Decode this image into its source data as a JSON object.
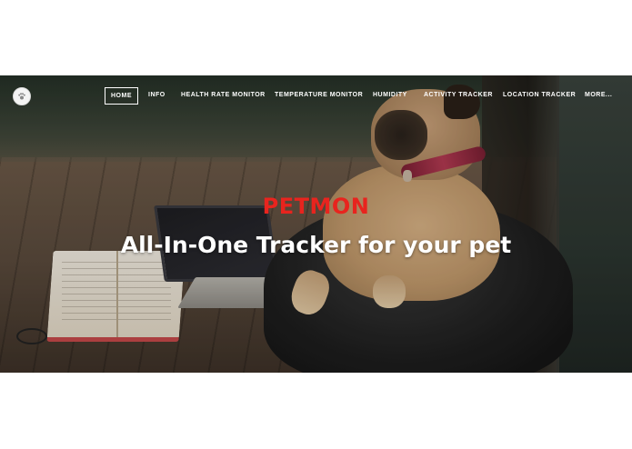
{
  "nav": {
    "logo_icon": "pet-logo-icon",
    "items": [
      {
        "label": "HOME",
        "active": true
      },
      {
        "label": "INFO",
        "active": false
      },
      {
        "label": "HEALTH RATE MONITOR",
        "active": false
      },
      {
        "label": "TEMPERATURE MONITOR",
        "active": false
      },
      {
        "label": "HUMIDITY",
        "active": false
      },
      {
        "label": "ACTIVITY TRACKER",
        "active": false
      },
      {
        "label": "LOCATION TRACKER",
        "active": false
      },
      {
        "label": "MORE...",
        "active": false
      }
    ]
  },
  "hero": {
    "title": "PETMON",
    "subtitle": "All-In-One Tracker for your pet"
  },
  "colors": {
    "title_accent": "#e8241e",
    "nav_text": "#ffffff",
    "subtitle_text": "#ffffff"
  }
}
